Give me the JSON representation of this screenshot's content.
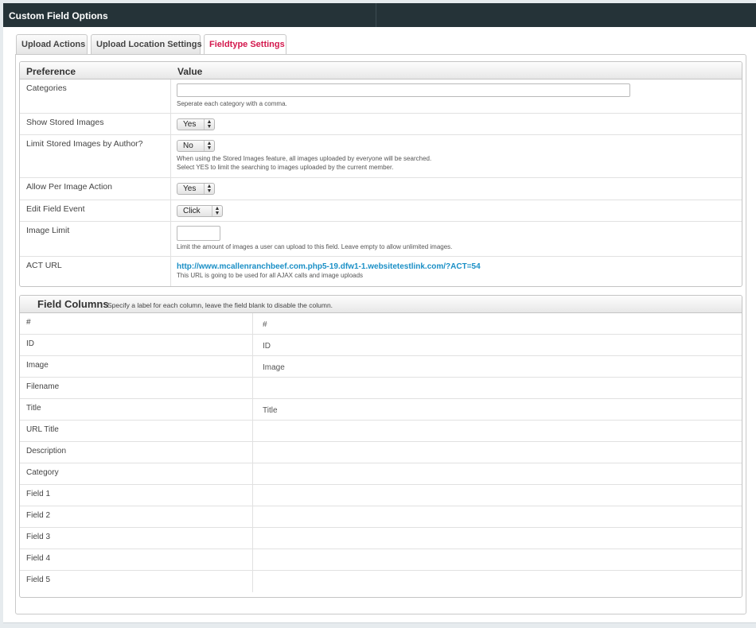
{
  "window": {
    "title": "Custom Field Options"
  },
  "tabs": [
    {
      "label": "Upload Actions"
    },
    {
      "label": "Upload Location Settings"
    },
    {
      "label": "Fieldtype Settings"
    }
  ],
  "preferences": {
    "header": {
      "preference": "Preference",
      "value": "Value"
    },
    "rows": [
      {
        "label": "Categories",
        "input_value": "",
        "help": "Seperate each category with a comma."
      },
      {
        "label": "Show Stored Images",
        "selected": "Yes"
      },
      {
        "label": "Limit Stored Images by Author?",
        "selected": "No",
        "help1": "When using the Stored Images feature, all images uploaded by everyone will be searched.",
        "help2": "Select YES to limit the searching to images uploaded by the current member."
      },
      {
        "label": "Allow Per Image Action",
        "selected": "Yes"
      },
      {
        "label": "Edit Field Event",
        "selected": "Click"
      },
      {
        "label": "Image Limit",
        "input_value": "",
        "help": "Limit the amount of images a user can upload to this field. Leave empty to allow unlimited images."
      },
      {
        "label": "ACT URL",
        "url": "http://www.mcallenranchbeef.com.php5-19.dfw1-1.websitetestlink.com/?ACT=54",
        "help": "This URL is going to be used for all AJAX calls and image uploads"
      }
    ]
  },
  "field_columns": {
    "title": "Field Columns",
    "subtitle": "Specify a label for each column, leave the field blank to disable the column.",
    "rows": [
      {
        "name": "#",
        "value": "#"
      },
      {
        "name": "ID",
        "value": "ID"
      },
      {
        "name": "Image",
        "value": "Image"
      },
      {
        "name": "Filename",
        "value": ""
      },
      {
        "name": "Title",
        "value": "Title"
      },
      {
        "name": "URL Title",
        "value": ""
      },
      {
        "name": "Description",
        "value": ""
      },
      {
        "name": "Category",
        "value": ""
      },
      {
        "name": "Field 1",
        "value": ""
      },
      {
        "name": "Field 2",
        "value": ""
      },
      {
        "name": "Field 3",
        "value": ""
      },
      {
        "name": "Field 4",
        "value": ""
      },
      {
        "name": "Field 5",
        "value": ""
      }
    ]
  },
  "colors": {
    "titlebar": "#253338",
    "active_tab": "#d3184d",
    "link": "#1a8fc6"
  }
}
